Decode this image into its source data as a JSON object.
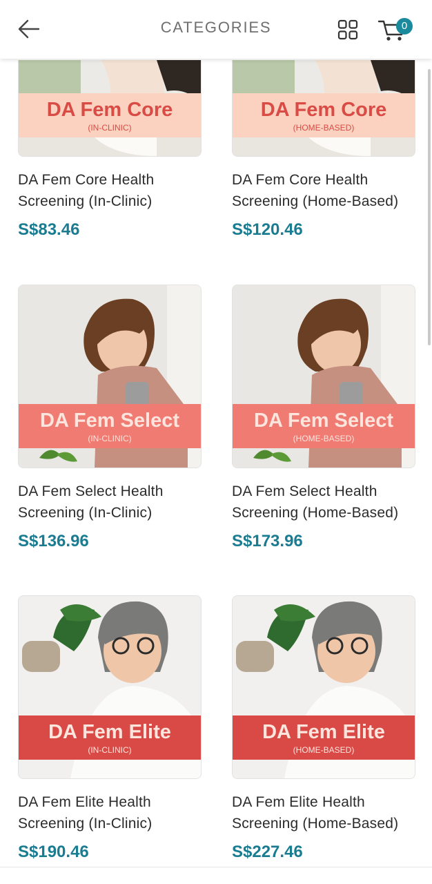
{
  "header": {
    "title": "CATEGORIES",
    "cart_count": "0"
  },
  "colors": {
    "accent": "#1a7c91",
    "core_banner": "#fbd2c0",
    "core_text": "#d94b45",
    "select_banner": "#ef7b72",
    "select_text": "#fde5de",
    "elite_banner": "#d94a46",
    "elite_text": "#fde5de"
  },
  "products": [
    {
      "banner_title": "DA Fem Core",
      "banner_sub": "(IN-CLINIC)",
      "name_line1": "DA Fem Core Health",
      "name_line2": "Screening (In-Clinic)",
      "price": "S$83.46"
    },
    {
      "banner_title": "DA Fem Core",
      "banner_sub": "(HOME-BASED)",
      "name_line1": "DA Fem Core Health",
      "name_line2": "Screening (Home-Based)",
      "price": "S$120.46"
    },
    {
      "banner_title": "DA Fem Select",
      "banner_sub": "(IN-CLINIC)",
      "name_line1": "DA Fem Select Health",
      "name_line2": "Screening (In-Clinic)",
      "price": "S$136.96"
    },
    {
      "banner_title": "DA Fem Select",
      "banner_sub": "(HOME-BASED)",
      "name_line1": "DA Fem Select Health",
      "name_line2": "Screening (Home-Based)",
      "price": "S$173.96"
    },
    {
      "banner_title": "DA Fem Elite",
      "banner_sub": "(IN-CLINIC)",
      "name_line1": "DA Fem Elite Health",
      "name_line2": "Screening (In-Clinic)",
      "price": "S$190.46"
    },
    {
      "banner_title": "DA Fem Elite",
      "banner_sub": "(HOME-BASED)",
      "name_line1": "DA Fem Elite Health",
      "name_line2": "Screening (Home-Based)",
      "price": "S$227.46"
    }
  ]
}
